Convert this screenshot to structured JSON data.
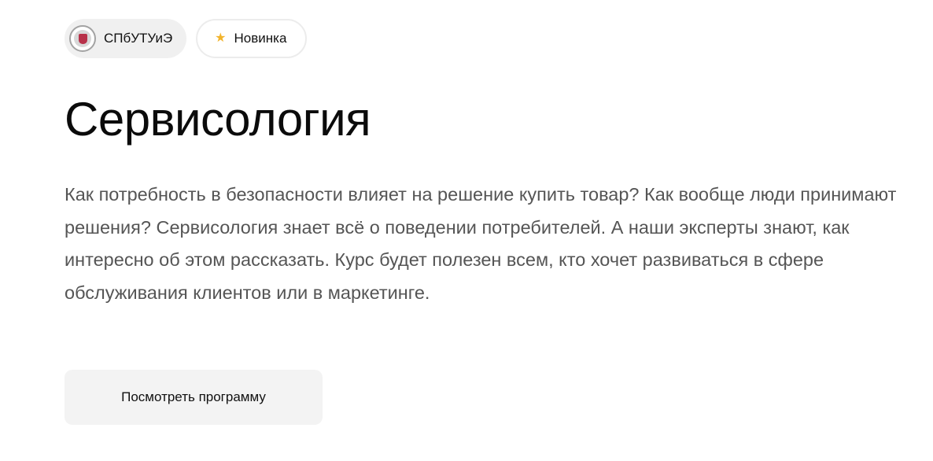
{
  "badges": {
    "university": {
      "label": "СПбУТУиЭ",
      "icon": "university-logo-icon"
    },
    "new": {
      "label": "Новинка",
      "icon": "star-icon",
      "icon_color": "#f2b42c"
    }
  },
  "course": {
    "title": "Сервисология",
    "description": "Как потребность в безопасности влияет на решение купить товар? Как вообще люди принимают решения? Сервисология знает всё о поведении потребителей. А наши эксперты знают, как интересно об этом рассказать. Курс будет полезен всем, кто хочет развиваться в сфере обслуживания клиентов или в маркетинге."
  },
  "actions": {
    "view_program_label": "Посмотреть программу"
  },
  "colors": {
    "title": "#0b0b0b",
    "description": "#555555",
    "button_bg": "#f3f3f3"
  }
}
